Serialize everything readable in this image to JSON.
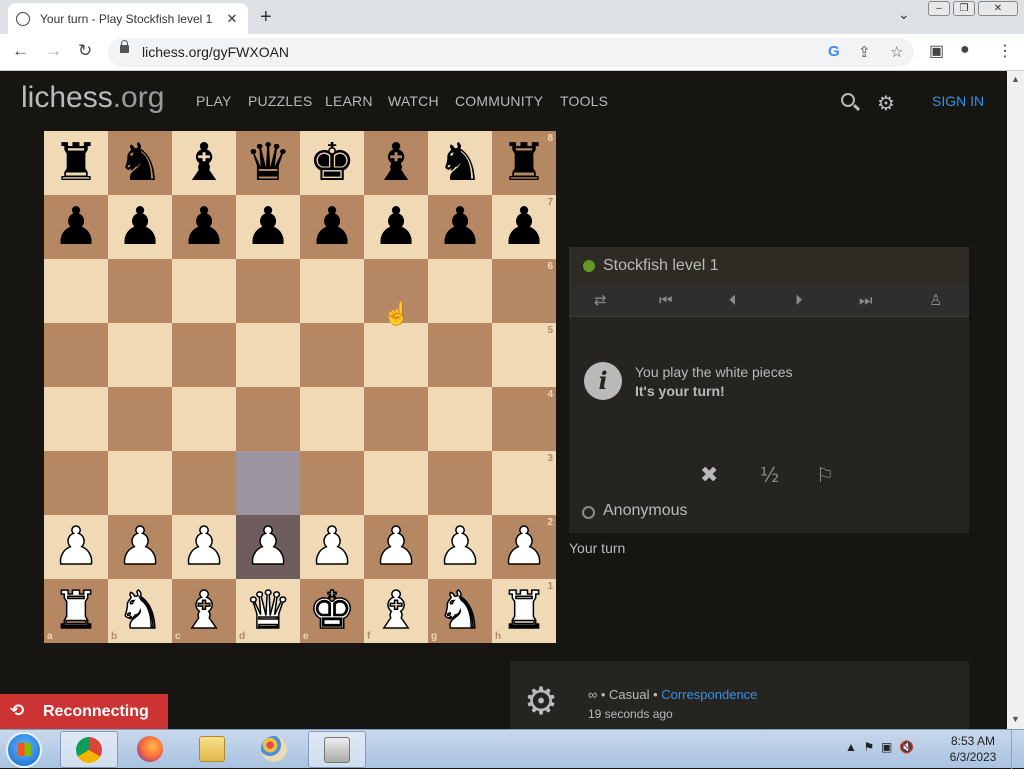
{
  "browser": {
    "tab_title": "Your turn - Play Stockfish level 1",
    "tab_close": "✕",
    "new_tab": "+",
    "url": "lichess.org/gyFWXOAN"
  },
  "site": {
    "logo": "lichess",
    "logo_domain": ".org",
    "nav": [
      "PLAY",
      "PUZZLES",
      "LEARN",
      "WATCH",
      "COMMUNITY",
      "TOOLS"
    ],
    "sign_in": "SIGN IN"
  },
  "board": {
    "ranks": [
      "8",
      "7",
      "6",
      "5",
      "4",
      "3",
      "2",
      "1"
    ],
    "files": [
      "a",
      "b",
      "c",
      "d",
      "e",
      "f",
      "g",
      "h"
    ],
    "position": [
      [
        "r",
        "n",
        "b",
        "q",
        "k",
        "b",
        "n",
        "r"
      ],
      [
        "p",
        "p",
        "p",
        "p",
        "p",
        "p",
        "p",
        "p"
      ],
      [
        "",
        "",
        "",
        "",
        "",
        "",
        "",
        ""
      ],
      [
        "",
        "",
        "",
        "",
        "",
        "",
        "",
        ""
      ],
      [
        "",
        "",
        "",
        "",
        "",
        "",
        "",
        ""
      ],
      [
        "",
        "",
        "",
        "",
        "",
        "",
        "",
        ""
      ],
      [
        "P",
        "P",
        "P",
        "P",
        "P",
        "P",
        "P",
        "P"
      ],
      [
        "R",
        "N",
        "B",
        "Q",
        "K",
        "B",
        "N",
        "R"
      ]
    ],
    "highlighted_squares": [
      "d3",
      "d2"
    ]
  },
  "game": {
    "opponent": "Stockfish level 1",
    "opponent_status_color": "#629924",
    "info_icon": "i",
    "info_line1": "You play the white pieces",
    "info_line2": "It's your turn!",
    "abort_glyph": "✖",
    "draw_glyph": "½",
    "resign_glyph": "⚐",
    "player": "Anonymous",
    "turn_status": "Your turn",
    "meta_prefix": "∞ • Casual • ",
    "meta_link": "Correspondence",
    "meta_time": "19 seconds ago"
  },
  "reconnecting": "Reconnecting",
  "taskbar": {
    "time": "8:53 AM",
    "date": "6/3/2023"
  }
}
